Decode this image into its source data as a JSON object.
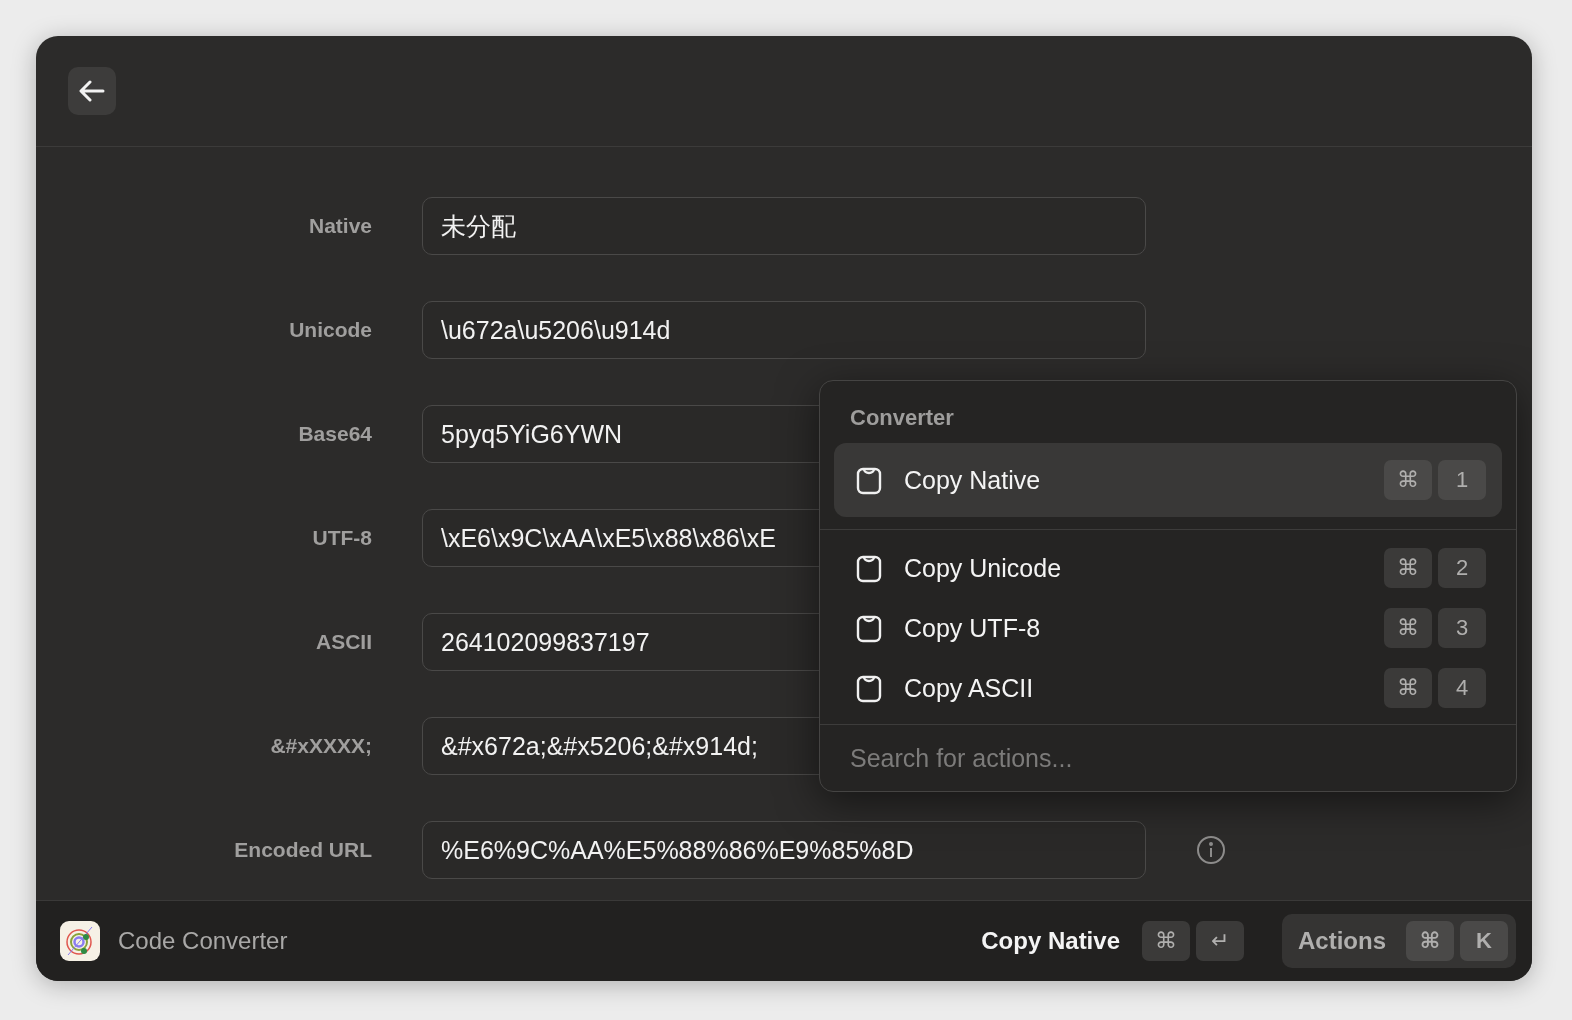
{
  "fields": [
    {
      "label": "Native",
      "value": "未分配"
    },
    {
      "label": "Unicode",
      "value": "\\u672a\\u5206\\u914d"
    },
    {
      "label": "Base64",
      "value": "5pyq5YiG6YWN"
    },
    {
      "label": "UTF-8",
      "value": "\\xE6\\x9C\\xAA\\xE5\\x88\\x86\\xE"
    },
    {
      "label": "ASCII",
      "value": "264102099837197"
    },
    {
      "label": "&#xXXXX;",
      "value": "&#x672a;&#x5206;&#x914d;"
    },
    {
      "label": "Encoded URL",
      "value": "%E6%9C%AA%E5%88%86%E9%85%8D"
    }
  ],
  "actions_panel": {
    "section": "Converter",
    "items": [
      {
        "label": "Copy Native",
        "selected": true,
        "keys": [
          "⌘",
          "1"
        ]
      },
      {
        "label": "Copy Unicode",
        "selected": false,
        "keys": [
          "⌘",
          "2"
        ]
      },
      {
        "label": "Copy UTF-8",
        "selected": false,
        "keys": [
          "⌘",
          "3"
        ]
      },
      {
        "label": "Copy ASCII",
        "selected": false,
        "keys": [
          "⌘",
          "4"
        ]
      }
    ],
    "search": {
      "placeholder": "Search for actions..."
    }
  },
  "footer": {
    "app_name": "Code Converter",
    "primary_action": {
      "label": "Copy Native",
      "keys": [
        "⌘",
        "↵"
      ]
    },
    "actions_button": {
      "label": "Actions",
      "keys": [
        "⌘",
        "K"
      ]
    }
  }
}
